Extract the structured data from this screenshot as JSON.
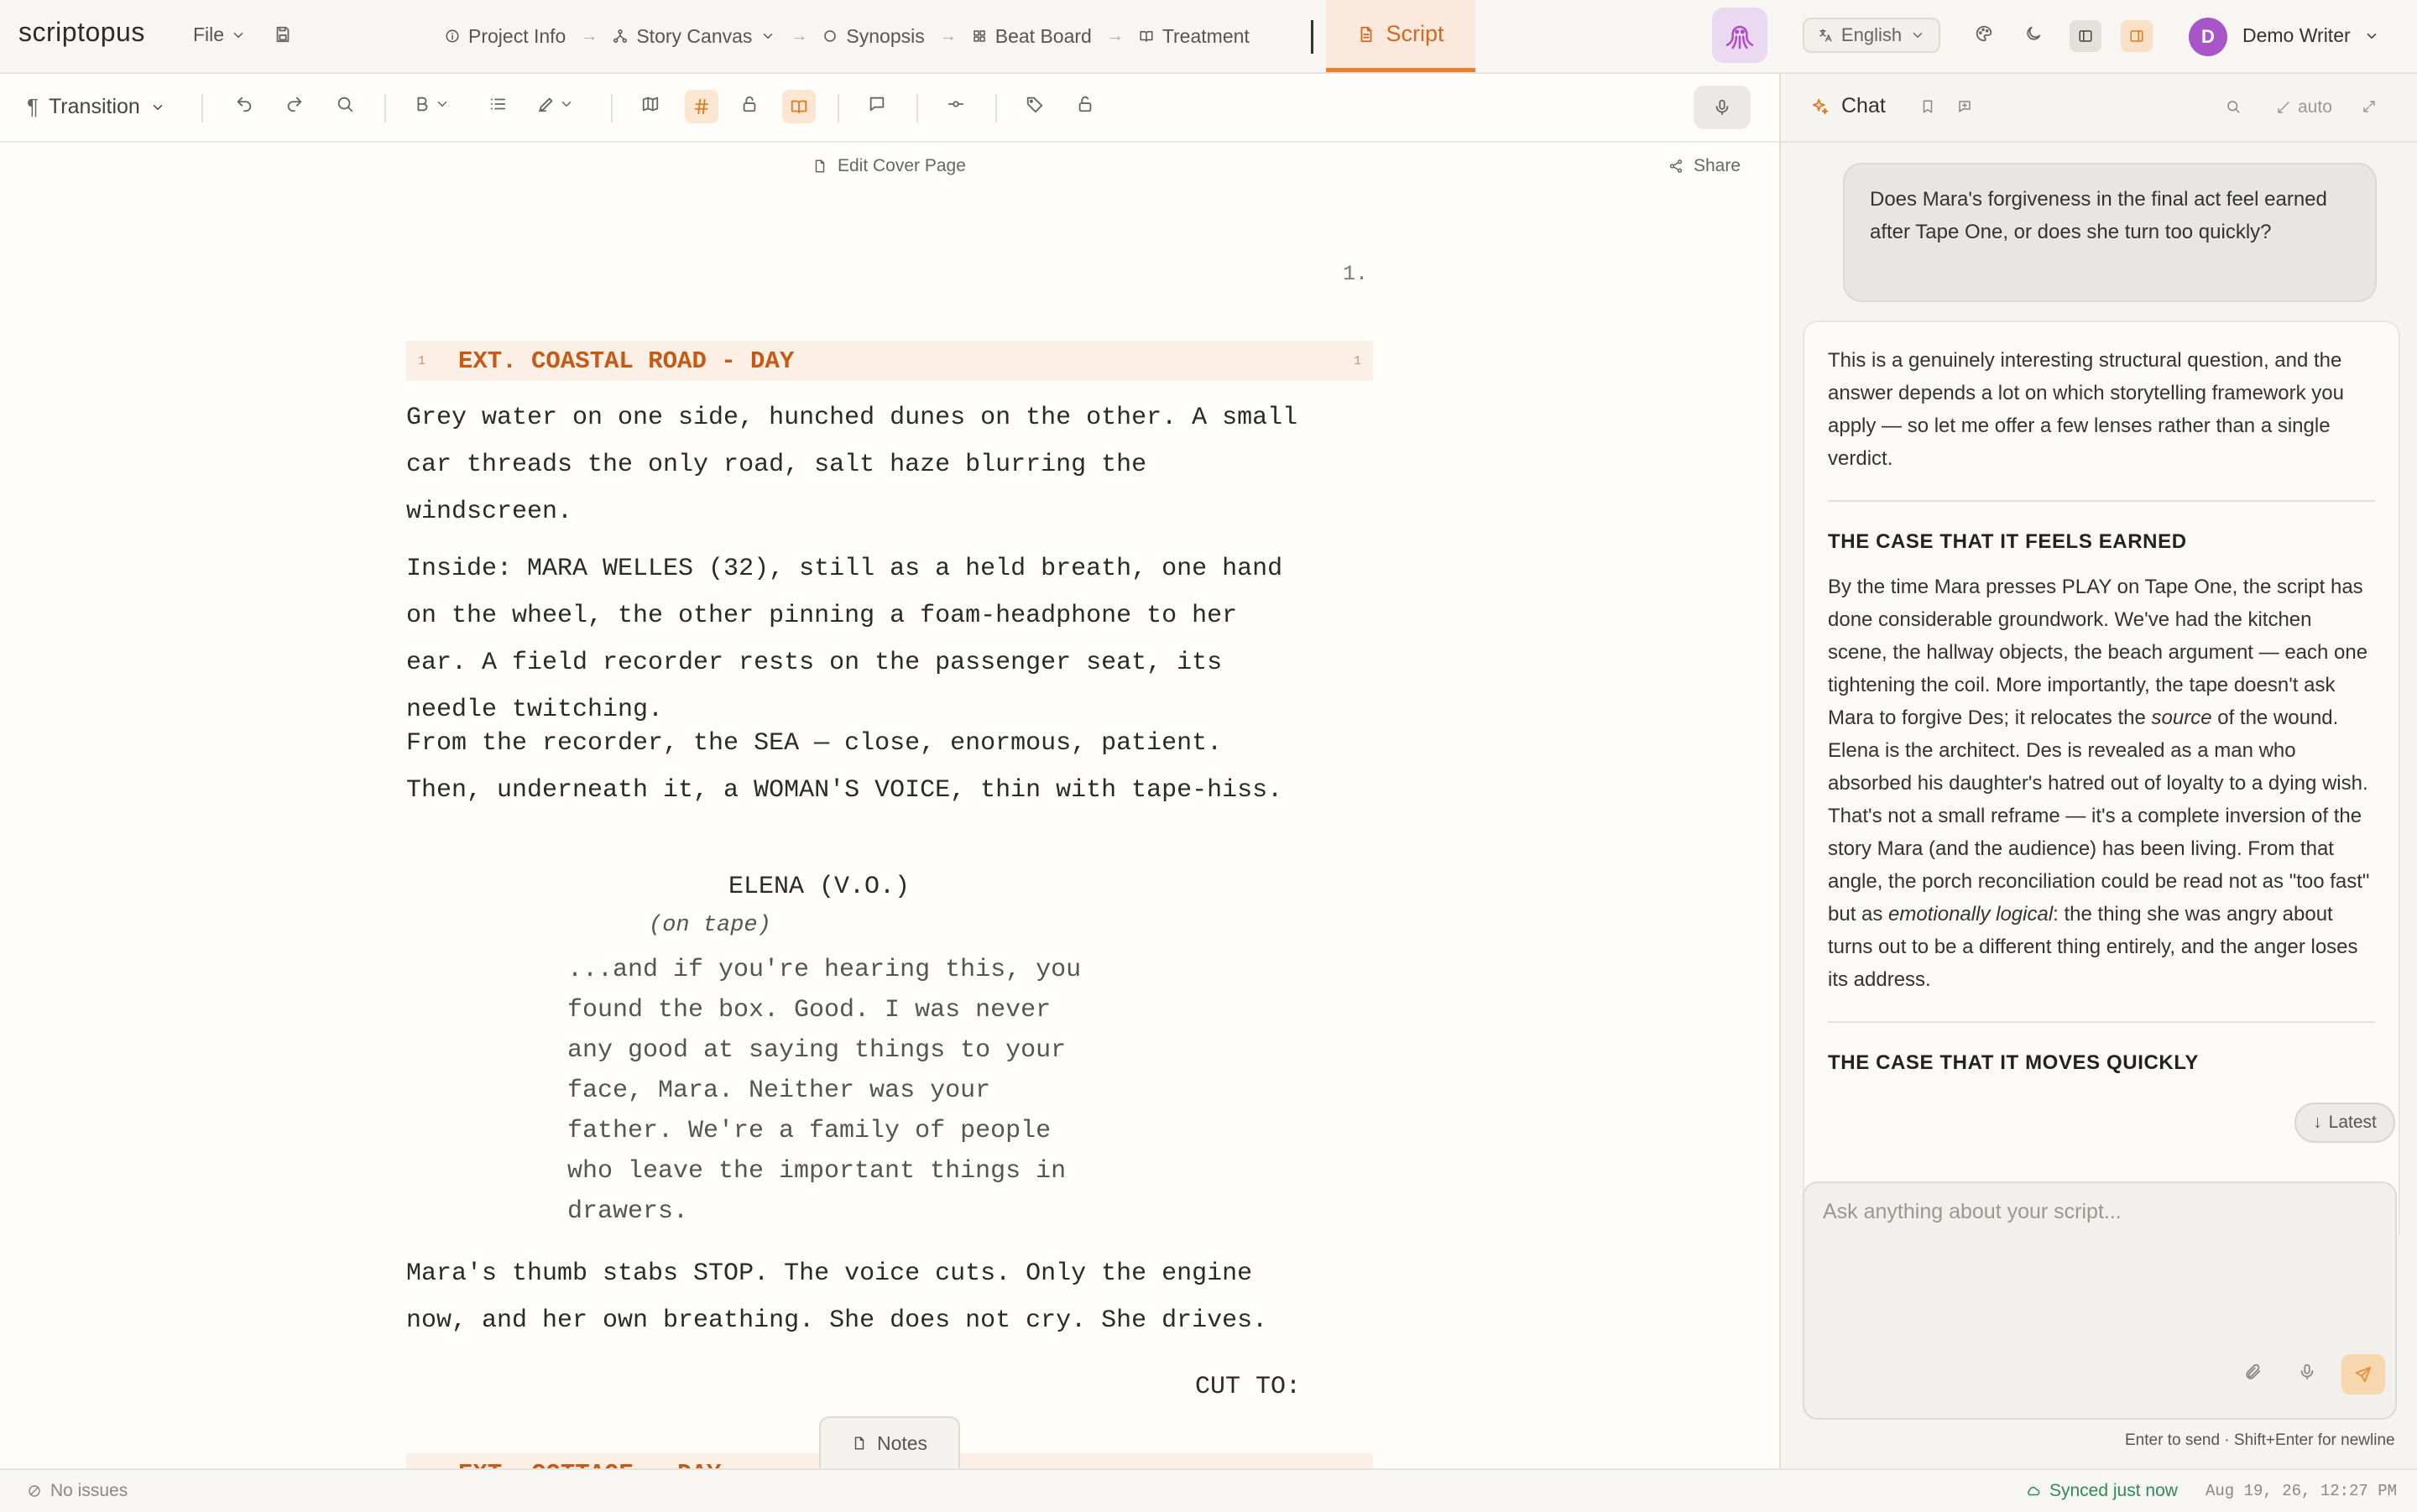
{
  "app": {
    "logo": "scriptopus"
  },
  "topbar": {
    "file_label": "File",
    "workflow": [
      {
        "label": "Project Info",
        "icon": "info-icon"
      },
      {
        "label": "Story Canvas",
        "icon": "canvas-icon"
      },
      {
        "label": "Synopsis",
        "icon": "circle-icon"
      },
      {
        "label": "Beat Board",
        "icon": "grid-icon"
      },
      {
        "label": "Treatment",
        "icon": "book-icon"
      }
    ],
    "active_tab": "Script",
    "language": "English",
    "user": {
      "initial": "D",
      "name": "Demo Writer"
    }
  },
  "toolbar": {
    "element_type": "Transition"
  },
  "editor": {
    "cover_link": "Edit Cover Page",
    "share_label": "Share",
    "page_number": "1.",
    "scene": {
      "number": "1",
      "heading": "EXT. COASTAL ROAD - DAY"
    },
    "action_1": [
      "Grey water on one side, hunched dunes on the other. A small",
      "car threads the only road, salt haze blurring the",
      "windscreen."
    ],
    "action_2": [
      "Inside: MARA WELLES (32), still as a held breath, one hand",
      "on the wheel, the other pinning a foam-headphone to her",
      "ear. A field recorder rests on the passenger seat, its",
      "needle twitching."
    ],
    "action_3": [
      "From the recorder, the SEA — close, enormous, patient.",
      "Then, underneath it, a WOMAN'S VOICE, thin with tape-hiss."
    ],
    "character": "ELENA (V.O.)",
    "parenthetical": "(on tape)",
    "dialogue": [
      "...and if you're hearing this, you",
      "found the box. Good. I was never",
      "any good at saying things to your",
      "face, Mara. Neither was your",
      "father. We're a family of people",
      "who leave the important things in",
      "drawers."
    ],
    "action_4": [
      "Mara's thumb stabs STOP. The voice cuts. Only the engine",
      "now, and her own breathing. She does not cry. She drives."
    ],
    "transition": "CUT TO:",
    "next_scene_heading": "EXT. COTTAGE - DAY",
    "notes_label": "Notes"
  },
  "status": {
    "issues": "No issues",
    "synced": "Synced just now",
    "timestamp": "Aug 19, 26, 12:27 PM"
  },
  "chat": {
    "title": "Chat",
    "auto_label": "auto",
    "user_message": "Does Mara's forgiveness in the final act feel earned after Tape One, or does she turn too quickly?",
    "assistant": {
      "intro": "This is a genuinely interesting structural question, and the answer depends a lot on which storytelling framework you apply — so let me offer a few lenses rather than a single verdict.",
      "section_1_heading": "THE CASE THAT IT FEELS EARNED",
      "section_1_a": "By the time Mara presses PLAY on Tape One, the script has done considerable groundwork. We've had the kitchen scene, the hallway objects, the beach argument — each one tightening the coil. More importantly, the tape doesn't ask Mara to forgive Des; it relocates the ",
      "section_1_em1": "source",
      "section_1_b": " of the wound. Elena is the architect. Des is revealed as a man who absorbed his daughter's hatred out of loyalty to a dying wish. That's not a small reframe — it's a complete inversion of the story Mara (and the audience) has been living. From that angle, the porch reconciliation could be read not as \"too fast\" but as ",
      "section_1_em2": "emotionally logical",
      "section_1_c": ": the thing she was angry about turns out to be a different thing entirely, and the anger loses its address.",
      "section_2_heading": "THE CASE THAT IT MOVES QUICKLY"
    },
    "latest_label": "Latest",
    "input_placeholder": "Ask anything about your script...",
    "input_hint": "Enter to send · Shift+Enter for newline"
  },
  "colors": {
    "accent": "#e8802c",
    "scene_heading": "#c45a14",
    "avatar": "#a855c7",
    "synced": "#2e8b57"
  }
}
